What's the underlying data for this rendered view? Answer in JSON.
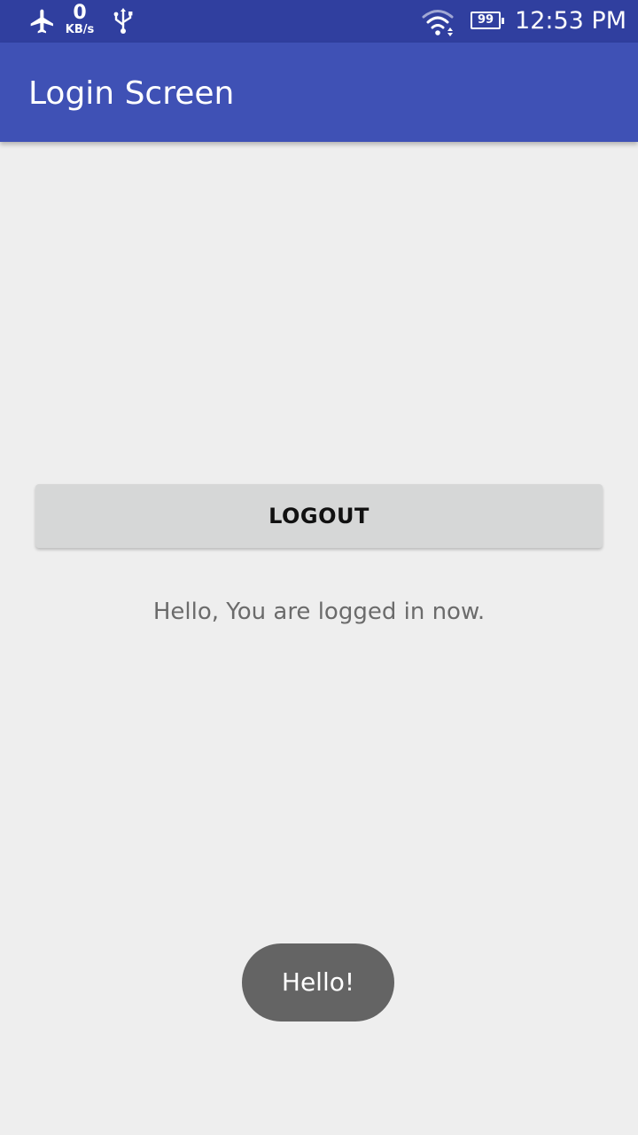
{
  "status_bar": {
    "icons": [
      "airplane-mode-icon",
      "usb-icon",
      "wifi-icon",
      "battery-icon"
    ],
    "network_speed_value": "0",
    "network_speed_unit": "KB/s",
    "battery_level": "99",
    "time": "12:53 PM"
  },
  "app_bar": {
    "title": "Login Screen"
  },
  "main": {
    "logout_label": "LOGOUT",
    "message": "Hello, You are logged in now."
  },
  "toast": {
    "text": "Hello!"
  },
  "colors": {
    "status_bar": "#303f9f",
    "app_bar": "#3f51b5",
    "background": "#eeeeee",
    "button": "#d6d7d7",
    "toast": "#646464"
  }
}
